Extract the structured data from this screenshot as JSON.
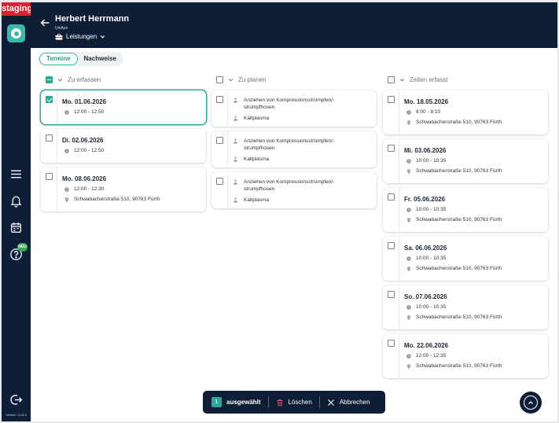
{
  "env_badge": "staging",
  "version": "Version: 3.14.2",
  "sidebar": {
    "new_badge": "NEU",
    "icons": [
      "menu-icon",
      "bell-icon",
      "calendar-icon",
      "help-icon",
      "logout-icon"
    ]
  },
  "header": {
    "name": "Herbert Herrmann",
    "org": "UniApo",
    "section": "Leistungen"
  },
  "tabs": [
    {
      "label": "Termine",
      "active": true
    },
    {
      "label": "Nachweise",
      "active": false
    }
  ],
  "columns": {
    "zu_erfassen": {
      "title": "Zu erfassen",
      "cards": [
        {
          "title": "Mo. 01.06.2026",
          "time": "12:00 - 12:50",
          "address": "",
          "checked": true
        },
        {
          "title": "Di. 02.06.2026",
          "time": "12:00 - 12:50",
          "address": "",
          "checked": false
        },
        {
          "title": "Mo. 08.06.2026",
          "time": "12:00 - 12:30",
          "address": "Schwabacherstraße 510, 90763 Fürth",
          "checked": false
        }
      ]
    },
    "zu_planen": {
      "title": "Zu planen",
      "cards": [
        {
          "task1": "Anziehen von Kompressionsstrümpfen/-",
          "task1b": "strumpfhosen",
          "task2": "Kaltplasma"
        },
        {
          "task1": "Anziehen von Kompressionsstrümpfen/-",
          "task1b": "strumpfhosen",
          "task2": "Kaltplasma"
        },
        {
          "task1": "Anziehen von Kompressionsstrümpfen/-",
          "task1b": "strumpfhosen",
          "task2": "Kaltplasma"
        }
      ]
    },
    "zeiten_erfasst": {
      "title": "Zeiten erfasst",
      "cards": [
        {
          "title": "Mo. 18.05.2026",
          "time": "8:00 - 8:10",
          "address": "Schwabacherstraße 510, 90763 Fürth"
        },
        {
          "title": "Mi. 03.06.2026",
          "time": "10:00 - 10:35",
          "address": "Schwabacherstraße 510, 90763 Fürth"
        },
        {
          "title": "Fr. 05.06.2026",
          "time": "10:00 - 10:35",
          "address": "Schwabacherstraße 510, 90763 Fürth"
        },
        {
          "title": "Sa. 06.06.2026",
          "time": "10:00 - 10:35",
          "address": "Schwabacherstraße 510, 90763 Fürth"
        },
        {
          "title": "So. 07.06.2026",
          "time": "10:00 - 10:35",
          "address": "Schwabacherstraße 510, 90763 Fürth"
        },
        {
          "title": "Mo. 22.06.2026",
          "time": "12:00 - 12:35",
          "address": "Schwabacherstraße 510, 90763 Fürth"
        }
      ]
    }
  },
  "actionbar": {
    "count": "1",
    "selected_label": "ausgewählt",
    "delete_label": "Löschen",
    "cancel_label": "Abbrechen"
  },
  "colors": {
    "navy": "#0f1e37",
    "accent": "#2aaa96",
    "staging": "#d9232e",
    "danger": "#e0475a"
  }
}
